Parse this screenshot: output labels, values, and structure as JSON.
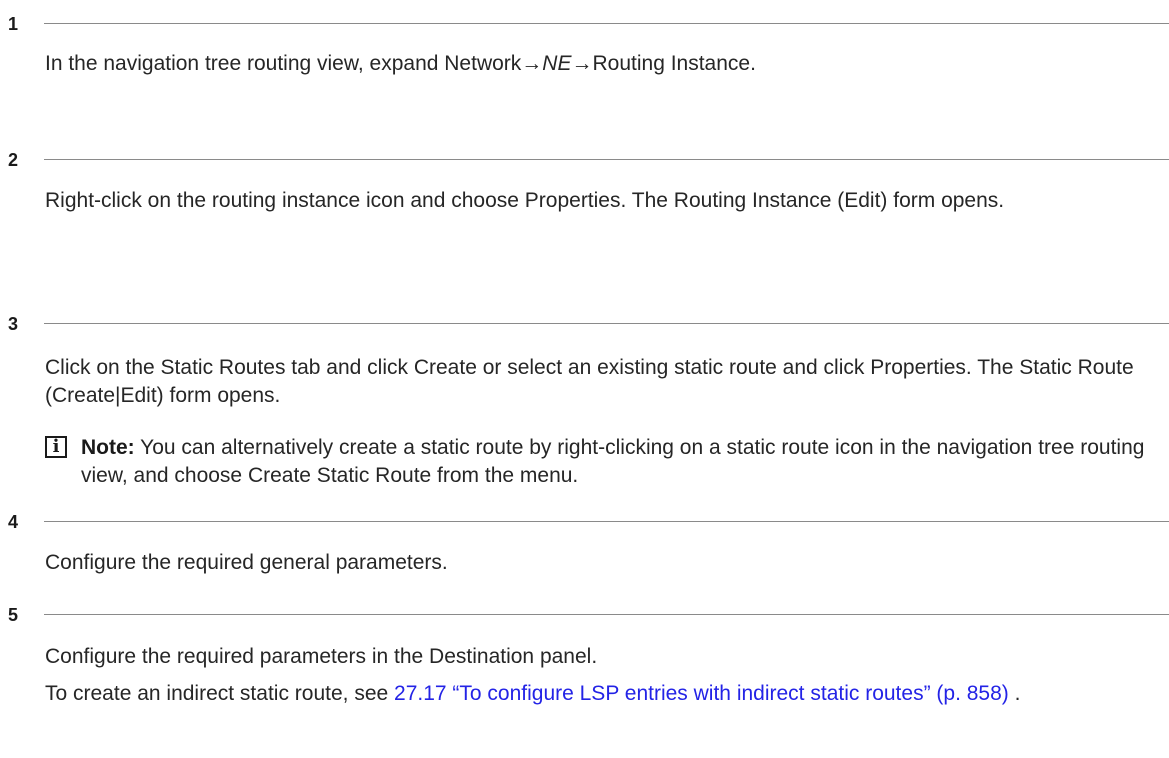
{
  "steps": [
    {
      "number": "1",
      "text_pre": "In the navigation tree routing view, expand Network→",
      "text_italic": "NE",
      "text_post": "→Routing Instance."
    },
    {
      "number": "2",
      "text": "Right-click on the routing instance icon and choose Properties. The Routing Instance (Edit) form opens."
    },
    {
      "number": "3",
      "text": "Click on the Static Routes tab and click Create or select an existing static route and click Properties. The Static Route (Create|Edit) form opens.",
      "note": {
        "icon": "info-icon",
        "glyph": "i",
        "label": "Note:",
        "text": "You can alternatively create a static route by right-clicking on a static route icon in the navigation tree routing view, and choose Create Static Route from the menu."
      }
    },
    {
      "number": "4",
      "text": "Configure the required general parameters."
    },
    {
      "number": "5",
      "text": "Configure the required parameters in the Destination panel.",
      "text2_pre": "To create an indirect static route, see ",
      "link_text": "27.17 “To configure LSP entries with indirect static routes” (p. 858)",
      "text2_post": " ."
    }
  ],
  "colors": {
    "link": "#2323e6",
    "rule": "#8a8a8a",
    "text": "#262626"
  }
}
